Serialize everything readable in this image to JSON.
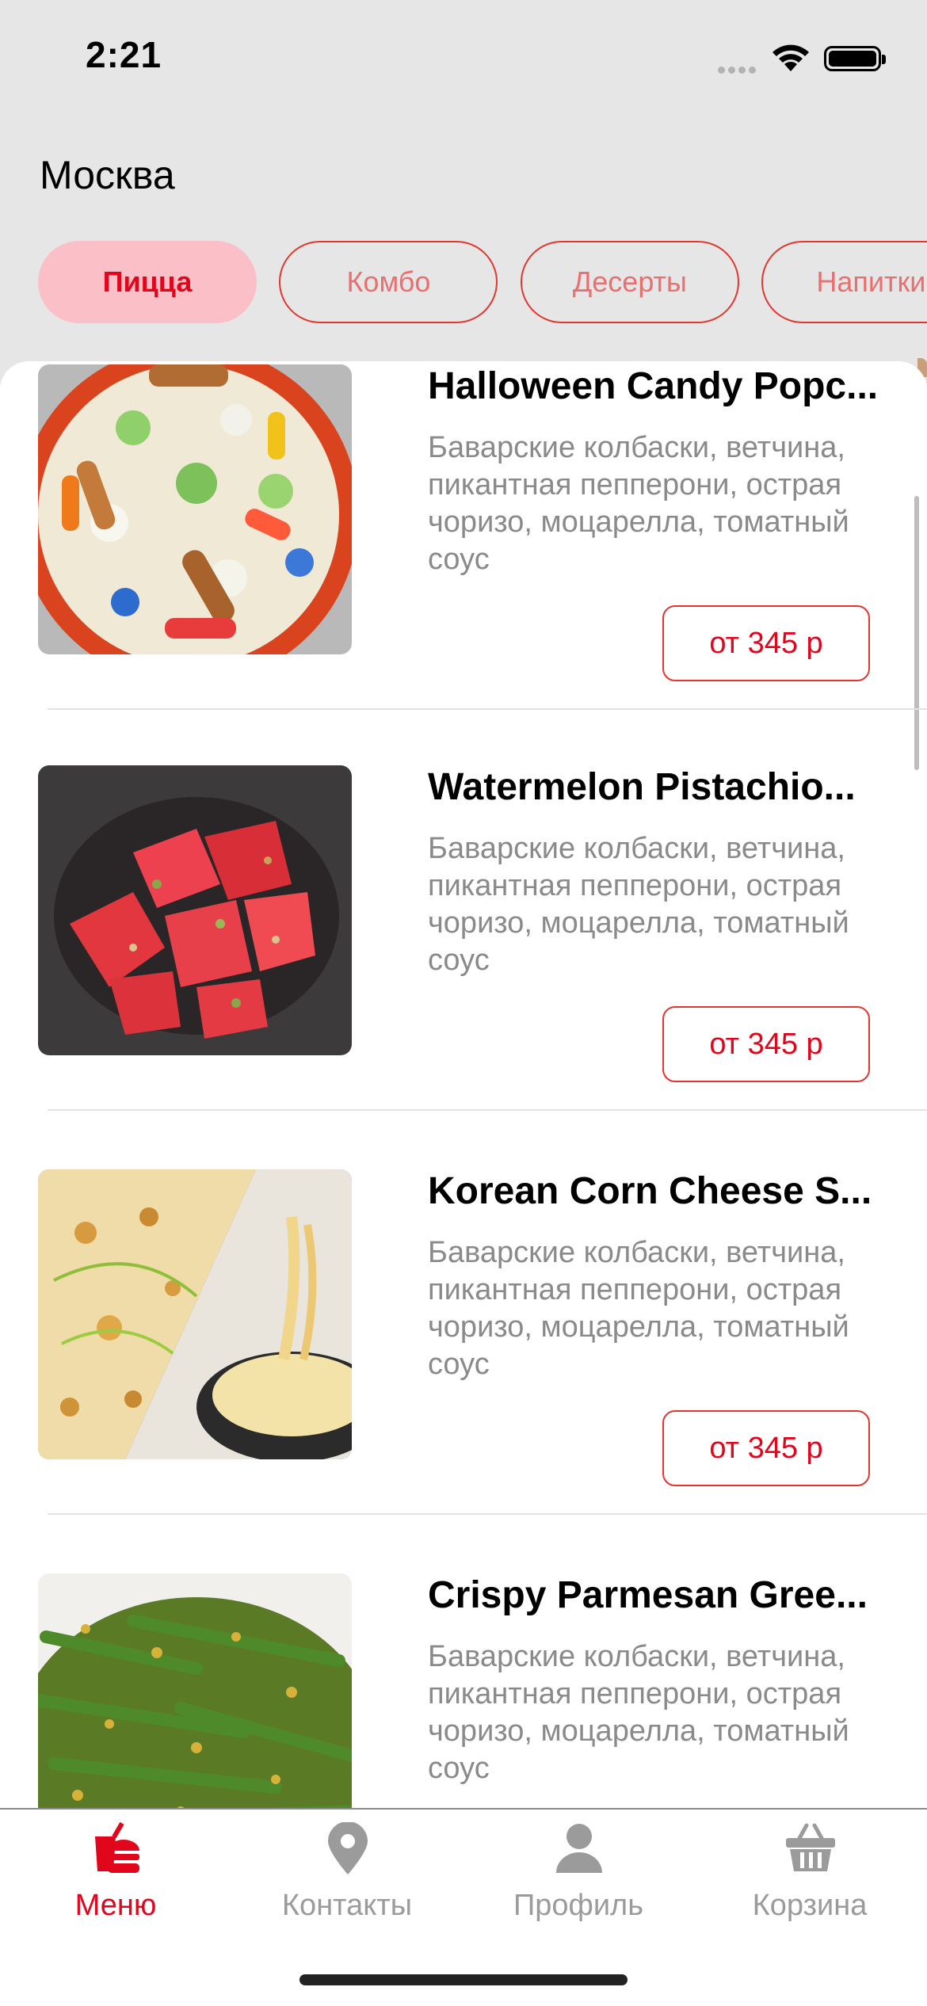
{
  "status_bar": {
    "time": "2:21"
  },
  "header": {
    "city": "Москва"
  },
  "categories": [
    {
      "label": "Пицца",
      "active": true
    },
    {
      "label": "Комбо",
      "active": false
    },
    {
      "label": "Десерты",
      "active": false
    },
    {
      "label": "Напитки",
      "active": false
    }
  ],
  "products": [
    {
      "name": "Halloween Candy Popc...",
      "description": "Баварские колбаски, ветчина, пикантная пепперони, острая чоризо, моцарелла, томатный соус",
      "price": "от 345 р"
    },
    {
      "name": "Watermelon Pistachio...",
      "description": "Баварские колбаски, ветчина, пикантная пепперони, острая чоризо, моцарелла, томатный соус",
      "price": "от 345 р"
    },
    {
      "name": "Korean Corn Cheese S...",
      "description": "Баварские колбаски, ветчина, пикантная пепперони, острая чоризо, моцарелла, томатный соус",
      "price": "от 345 р"
    },
    {
      "name": "Crispy Parmesan Gree...",
      "description": "Баварские колбаски, ветчина, пикантная пепперони, острая чоризо, моцарелла, томатный соус",
      "price": ""
    }
  ],
  "tabbar": {
    "items": [
      {
        "label": "Меню",
        "icon": "menu-food-icon",
        "active": true
      },
      {
        "label": "Контакты",
        "icon": "location-pin-icon",
        "active": false
      },
      {
        "label": "Профиль",
        "icon": "person-icon",
        "active": false
      },
      {
        "label": "Корзина",
        "icon": "basket-icon",
        "active": false
      }
    ]
  },
  "colors": {
    "accent": "#e2061d",
    "chip_active_bg": "#fbbfc7",
    "background": "#e6e6e6"
  }
}
